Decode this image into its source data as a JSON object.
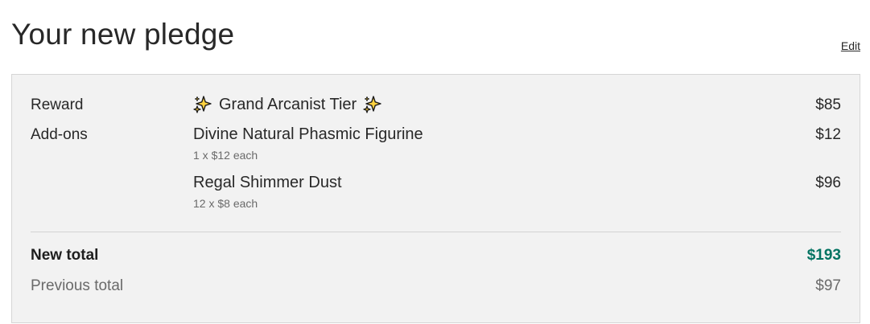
{
  "header": {
    "title": "Your new pledge",
    "edit_label": "Edit"
  },
  "reward": {
    "label": "Reward",
    "name": "Grand Arcanist Tier",
    "price": "$85",
    "icon": "sparkles-icon"
  },
  "addons": {
    "label": "Add-ons",
    "items": [
      {
        "name": "Divine Natural Phasmic Figurine",
        "detail": "1 x $12 each",
        "price": "$12"
      },
      {
        "name": "Regal Shimmer Dust",
        "detail": "12 x $8 each",
        "price": "$96"
      }
    ]
  },
  "totals": {
    "new_label": "New total",
    "new_value": "$193",
    "previous_label": "Previous total",
    "previous_value": "$97"
  },
  "colors": {
    "accent_green": "#037362",
    "box_background": "#f2f2f2",
    "sparkle_fill": "#ffd23f"
  }
}
